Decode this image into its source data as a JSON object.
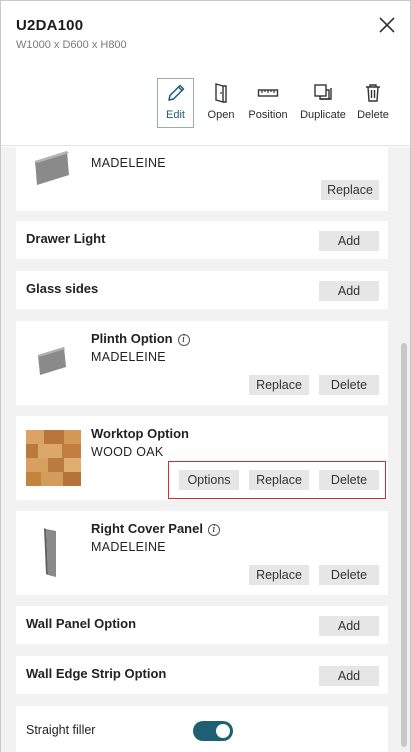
{
  "header": {
    "title": "U2DA100",
    "dimensions": "W1000 x D600 x H800"
  },
  "toolbar": {
    "edit": "Edit",
    "open": "Open",
    "position": "Position",
    "duplicate": "Duplicate",
    "delete": "Delete"
  },
  "items": {
    "top_partial": {
      "subtitle": "MADELEINE",
      "replace": "Replace"
    },
    "drawer_light": {
      "name": "Drawer Light",
      "add": "Add"
    },
    "glass_sides": {
      "name": "Glass sides",
      "add": "Add"
    },
    "plinth": {
      "name": "Plinth Option",
      "subtitle": "MADELEINE",
      "replace": "Replace",
      "delete": "Delete"
    },
    "worktop": {
      "name": "Worktop Option",
      "subtitle": "WOOD OAK",
      "options": "Options",
      "replace": "Replace",
      "delete": "Delete"
    },
    "right_cover": {
      "name": "Right Cover Panel",
      "subtitle": "MADELEINE",
      "replace": "Replace",
      "delete": "Delete"
    },
    "wall_panel": {
      "name": "Wall Panel Option",
      "add": "Add"
    },
    "wall_edge": {
      "name": "Wall Edge Strip Option",
      "add": "Add"
    }
  },
  "filler": {
    "label": "Straight filler",
    "enabled": true
  },
  "colors": {
    "accent": "#1f5f73",
    "button_bg": "#e6e6e6",
    "highlight": "#cc3030",
    "list_bg": "#f2f2f2"
  },
  "icons": [
    "close-icon",
    "pencil-icon",
    "door-open-icon",
    "ruler-icon",
    "duplicate-icon",
    "trash-icon",
    "info-icon"
  ]
}
